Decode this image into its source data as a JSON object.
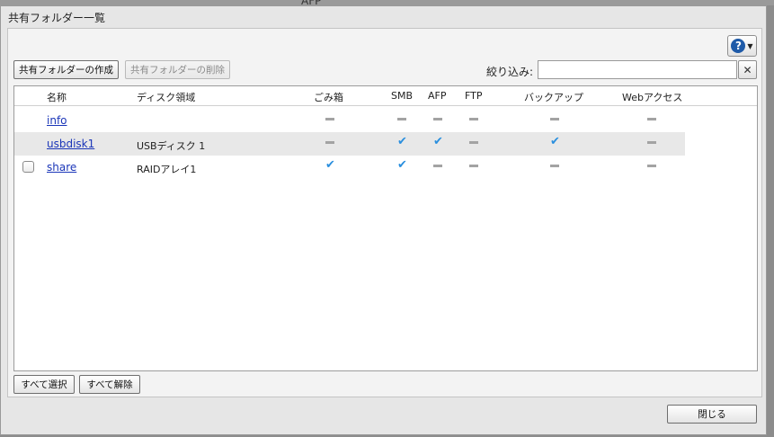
{
  "background": {
    "label": "AFP"
  },
  "dialog": {
    "title": "共有フォルダー一覧",
    "create_button": "共有フォルダーの作成",
    "delete_button": "共有フォルダーの削除",
    "filter_label": "絞り込み:",
    "filter_value": "",
    "clear_icon": "✕",
    "help_icon": "?",
    "select_all_button": "すべて選択",
    "deselect_all_button": "すべて解除",
    "close_button": "閉じる"
  },
  "columns": {
    "name": "名称",
    "disk": "ディスク領域",
    "trash": "ごみ箱",
    "smb": "SMB",
    "afp": "AFP",
    "ftp": "FTP",
    "backup": "バックアップ",
    "web": "Webアクセス"
  },
  "rows": [
    {
      "name": "info",
      "disk": "",
      "checkbox": false,
      "trash": "dash",
      "smb": "dash",
      "afp": "dash",
      "ftp": "dash",
      "backup": "dash",
      "web": "dash"
    },
    {
      "name": "usbdisk1",
      "disk": "USBディスク 1",
      "checkbox": false,
      "trash": "dash",
      "smb": "check",
      "afp": "check",
      "ftp": "dash",
      "backup": "check",
      "web": "dash"
    },
    {
      "name": "share",
      "disk": "RAIDアレイ1",
      "checkbox": true,
      "trash": "check",
      "smb": "check",
      "afp": "dash",
      "ftp": "dash",
      "backup": "dash",
      "web": "dash"
    }
  ],
  "colors": {
    "link": "#1a35b8",
    "check": "#2a8fde",
    "help": "#1e5aa8"
  }
}
